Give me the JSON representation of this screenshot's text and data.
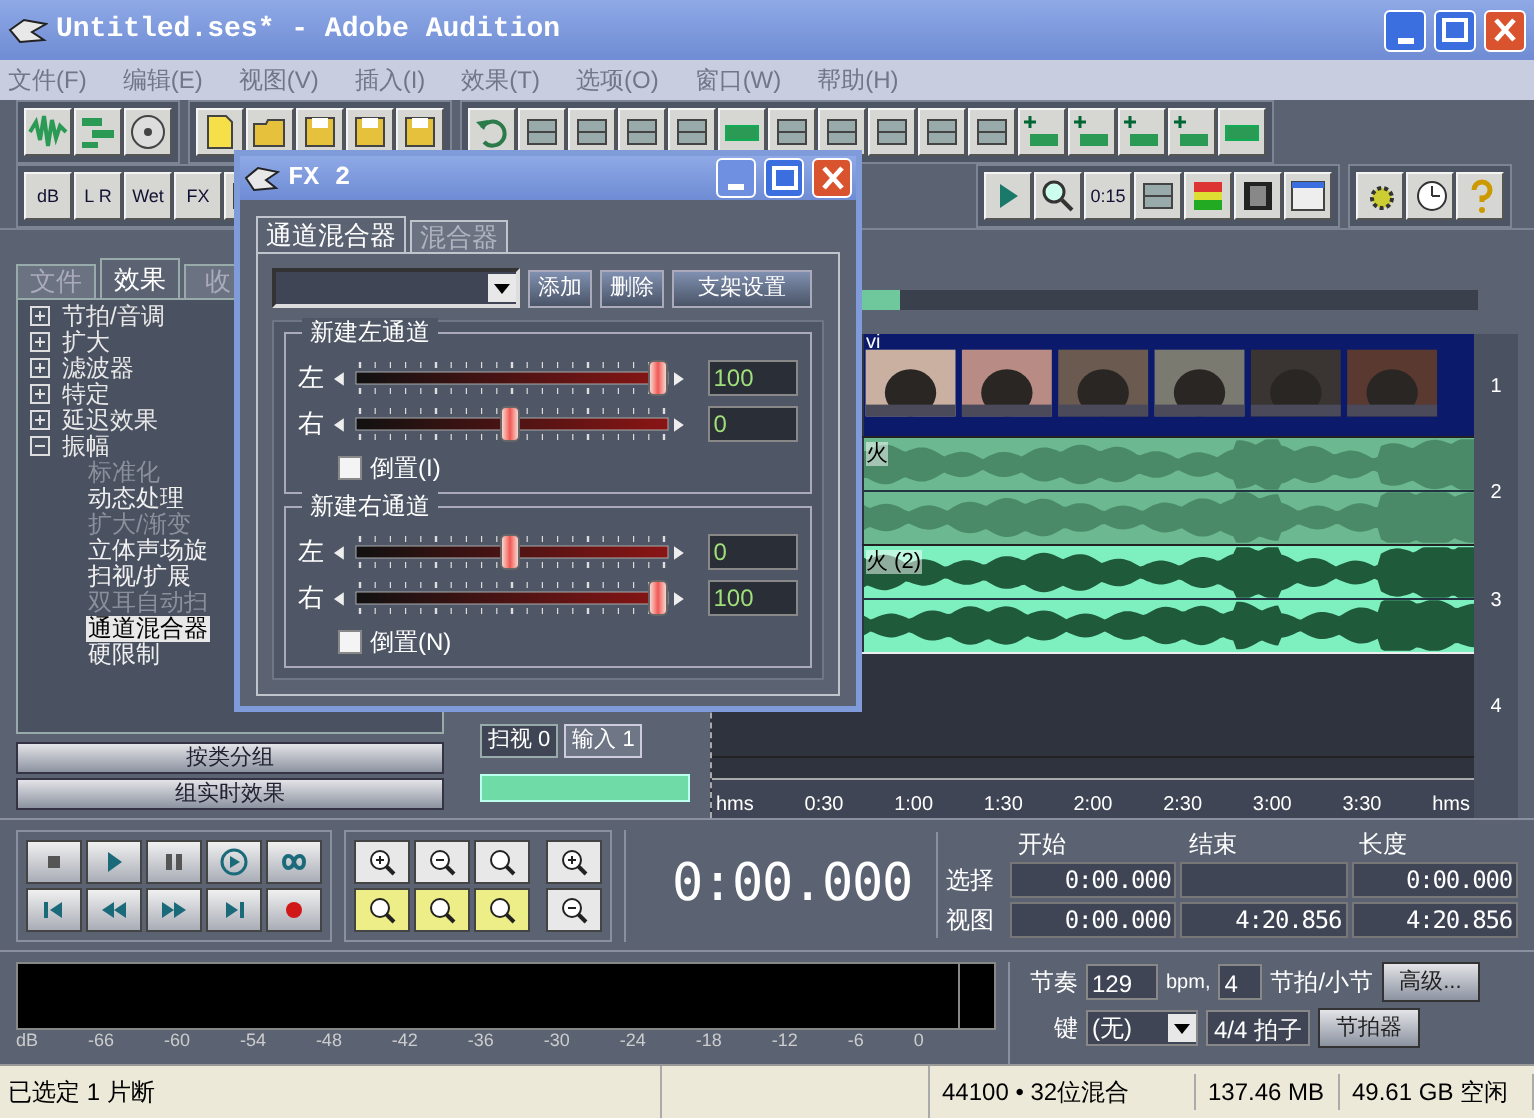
{
  "window": {
    "title": "Untitled.ses* - Adobe Audition"
  },
  "menu": [
    "文件(F)",
    "编辑(E)",
    "视图(V)",
    "插入(I)",
    "效果(T)",
    "选项(O)",
    "窗口(W)",
    "帮助(H)"
  ],
  "toolbar_labels": [
    {
      "kind": "db",
      "text": "dB"
    },
    {
      "kind": "lr",
      "text": "L R"
    },
    {
      "kind": "wet",
      "text": "Wet"
    },
    {
      "kind": "fx",
      "text": "FX"
    },
    {
      "kind": "time",
      "text": "0:15"
    }
  ],
  "left_panel": {
    "tabs": [
      {
        "label": "文件",
        "selected": false
      },
      {
        "label": "效果",
        "selected": true
      },
      {
        "label": "收",
        "selected": false
      }
    ],
    "tree": [
      {
        "label": "节拍/音调",
        "expanded": false
      },
      {
        "label": "扩大",
        "expanded": false
      },
      {
        "label": "滤波器",
        "expanded": false
      },
      {
        "label": "特定",
        "expanded": false
      },
      {
        "label": "延迟效果",
        "expanded": false
      },
      {
        "label": "振幅",
        "expanded": true,
        "children": [
          {
            "label": "标准化",
            "disabled": true,
            "selected": false
          },
          {
            "label": "动态处理",
            "disabled": false,
            "selected": false
          },
          {
            "label": "扩大/渐变",
            "disabled": true,
            "selected": false
          },
          {
            "label": "立体声场旋",
            "disabled": false,
            "selected": false
          },
          {
            "label": "扫视/扩展",
            "disabled": false,
            "selected": false
          },
          {
            "label": "双耳自动扫",
            "disabled": true,
            "selected": false
          },
          {
            "label": "通道混合器",
            "disabled": false,
            "selected": true
          },
          {
            "label": "硬限制",
            "disabled": false,
            "selected": false
          }
        ]
      }
    ],
    "buttons": [
      "按类分组",
      "组实时效果"
    ]
  },
  "mixer": {
    "pan": "扫视 0",
    "input": "输入 1"
  },
  "timeline": {
    "tracks": [
      {
        "number": "1",
        "kind": "video",
        "label": "vi",
        "selected": false
      },
      {
        "number": "2",
        "kind": "audio",
        "label": "火",
        "selected": false
      },
      {
        "number": "3",
        "kind": "audio",
        "label": "火 (2)",
        "selected": true
      },
      {
        "number": "4",
        "kind": "empty",
        "selected": false
      }
    ],
    "ruler": [
      "hms",
      "0:30",
      "1:00",
      "1:30",
      "2:00",
      "2:30",
      "3:00",
      "3:30",
      "hms"
    ]
  },
  "fx_dialog": {
    "title": "FX 2",
    "tabs": [
      {
        "label": "通道混合器",
        "selected": true
      },
      {
        "label": "混合器",
        "selected": false
      }
    ],
    "buttons": [
      "添加",
      "删除",
      "支架设置"
    ],
    "groups": [
      {
        "title": "新建左通道",
        "sliders": [
          {
            "label": "左",
            "level": 1,
            "value": "100"
          },
          {
            "label": "右",
            "level": 0.5,
            "value": "0"
          }
        ],
        "invert": {
          "label": "倒置(I)",
          "checked": false
        }
      },
      {
        "title": "新建右通道",
        "sliders": [
          {
            "label": "左",
            "level": 0.5,
            "value": "0"
          },
          {
            "label": "右",
            "level": 1,
            "value": "100"
          }
        ],
        "invert": {
          "label": "倒置(N)",
          "checked": false
        }
      }
    ]
  },
  "transport": {
    "time": "0:00.000",
    "headers": [
      "开始",
      "结束",
      "长度"
    ],
    "rows": [
      {
        "label": "选择",
        "start": "0:00.000",
        "length": "0:00.000"
      },
      {
        "label": "视图",
        "start": "0:00.000",
        "end": "4:20.856",
        "length": "4:20.856"
      }
    ]
  },
  "meter": {
    "ticks": [
      "dB",
      "-66",
      "-60",
      "-54",
      "-48",
      "-42",
      "-36",
      "-30",
      "-24",
      "-18",
      "-12",
      "-6",
      "0"
    ]
  },
  "tempo": {
    "tempo_label": "节奏",
    "tempo": "129",
    "unit": "bpm,",
    "beats": "4",
    "beats_label": "节拍/小节",
    "advanced": "高级...",
    "key_label": "键",
    "key": "(无)",
    "time_signature": "4/4 拍子",
    "metronome": "节拍器"
  },
  "status_bar": [
    "已选定 1 片断",
    "44100 • 32位混合",
    "137.46 MB",
    "49.61 GB 空闲"
  ]
}
